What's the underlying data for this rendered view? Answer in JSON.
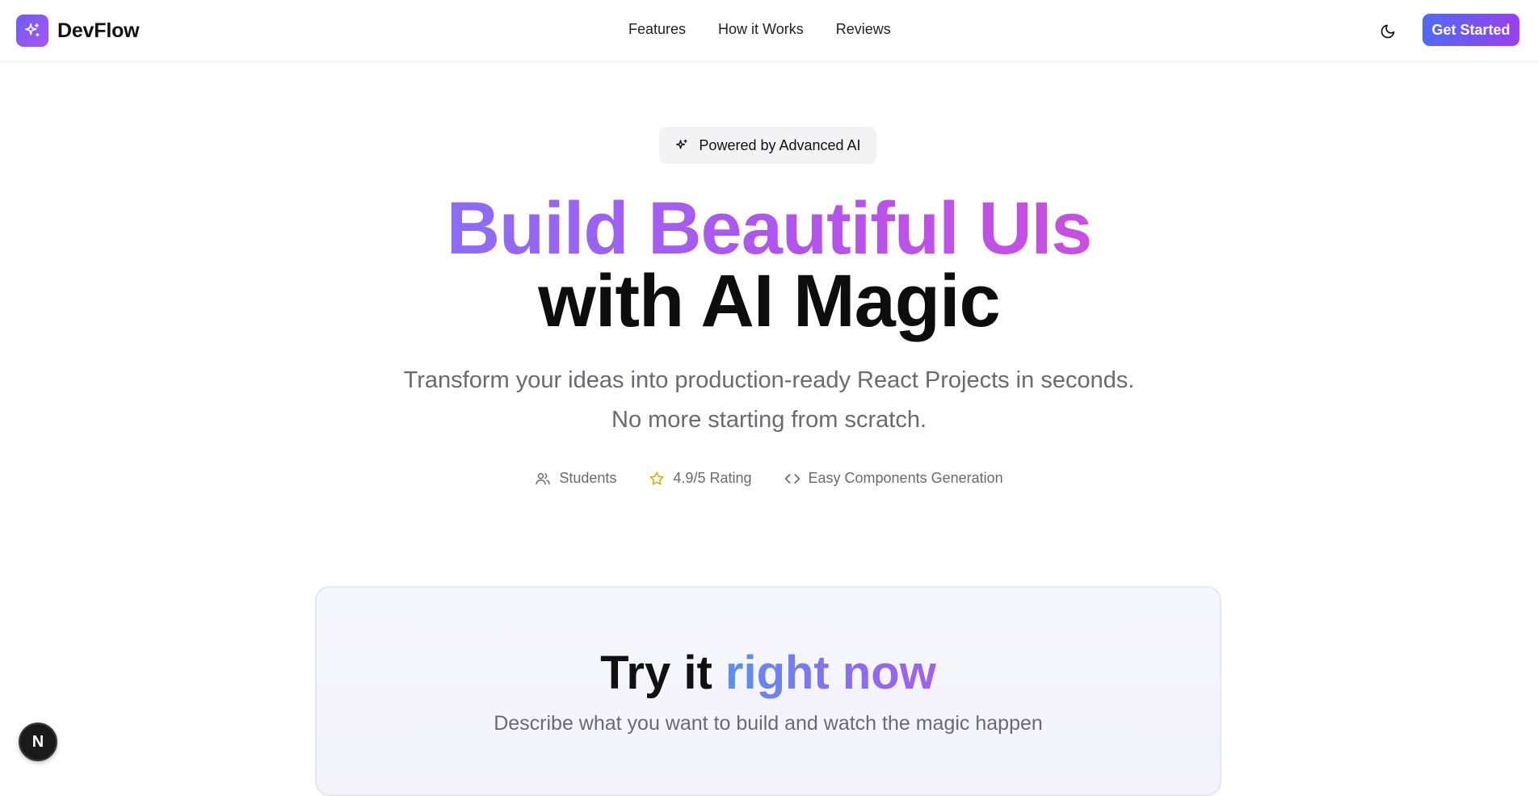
{
  "header": {
    "brand": "DevFlow",
    "nav": [
      {
        "label": "Features"
      },
      {
        "label": "How it Works"
      },
      {
        "label": "Reviews"
      }
    ],
    "cta_label": "Get Started"
  },
  "hero": {
    "badge": "Powered by Advanced AI",
    "headline_gradient": "Build Beautiful UIs",
    "headline_plain": "with AI Magic",
    "subtitle_line1": "Transform your ideas into production-ready React Projects in seconds.",
    "subtitle_line2": "No more starting from scratch.",
    "stats": [
      {
        "icon": "users-icon",
        "label": "Students"
      },
      {
        "icon": "star-icon",
        "label": "4.9/5 Rating"
      },
      {
        "icon": "code-icon",
        "label": "Easy Components Generation"
      }
    ]
  },
  "try_section": {
    "title_plain": "Try it",
    "title_gradient": "right now",
    "subtitle": "Describe what you want to build and watch the magic happen"
  },
  "floating_badge": {
    "label": "N"
  },
  "colors": {
    "brand_gradient_start": "#6d5cf6",
    "brand_gradient_end": "#a855f7",
    "cta_gradient_start": "#4f6bf5",
    "cta_gradient_end": "#9b3ff0",
    "star": "#e0a800",
    "muted_text": "#6a6a70"
  }
}
